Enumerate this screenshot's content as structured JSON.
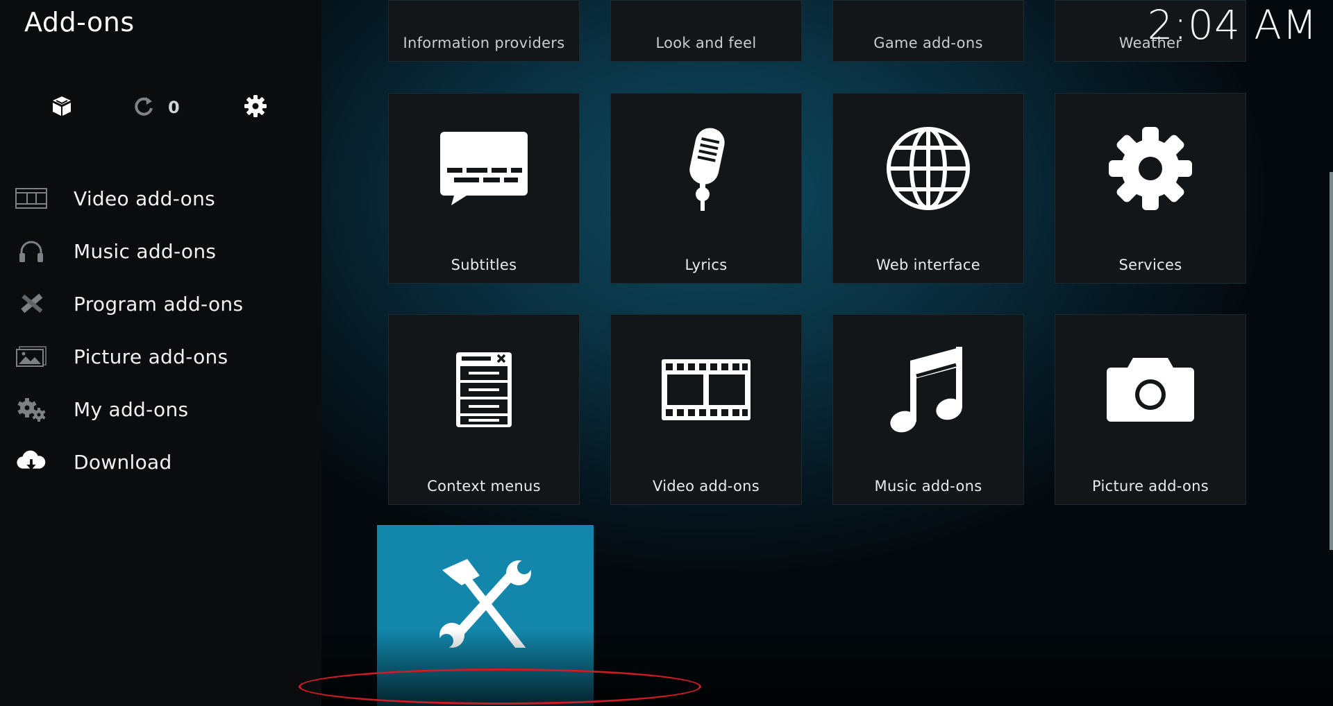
{
  "header": {
    "title": "Add-ons",
    "clock": "2:04 AM"
  },
  "toolbar": {
    "install_icon": "open-box-icon",
    "update_icon": "refresh-icon",
    "update_count": "0",
    "settings_icon": "gear-icon"
  },
  "sidebar": {
    "items": [
      {
        "label": "Video add-ons",
        "icon": "film-strip-icon"
      },
      {
        "label": "Music add-ons",
        "icon": "headphones-icon"
      },
      {
        "label": "Program add-ons",
        "icon": "pencil-ruler-icon"
      },
      {
        "label": "Picture add-ons",
        "icon": "pictures-icon"
      },
      {
        "label": "My add-ons",
        "icon": "gears-icon"
      },
      {
        "label": "Download",
        "icon": "cloud-download-icon"
      }
    ]
  },
  "grid": {
    "partial_row": [
      "Information providers",
      "Look and feel",
      "Game add-ons",
      "Weather"
    ],
    "row1": [
      {
        "label": "Subtitles",
        "icon": "speech-bubble-icon"
      },
      {
        "label": "Lyrics",
        "icon": "microphone-icon"
      },
      {
        "label": "Web interface",
        "icon": "globe-icon"
      },
      {
        "label": "Services",
        "icon": "gear-icon"
      }
    ],
    "row2": [
      {
        "label": "Context menus",
        "icon": "context-menu-icon"
      },
      {
        "label": "Video add-ons",
        "icon": "film-icon"
      },
      {
        "label": "Music add-ons",
        "icon": "music-note-icon"
      },
      {
        "label": "Picture add-ons",
        "icon": "camera-icon"
      }
    ],
    "focused": {
      "icon": "hammer-wrench-icon"
    }
  },
  "colors": {
    "accent": "#1287ab",
    "annotation": "#d11b24"
  }
}
